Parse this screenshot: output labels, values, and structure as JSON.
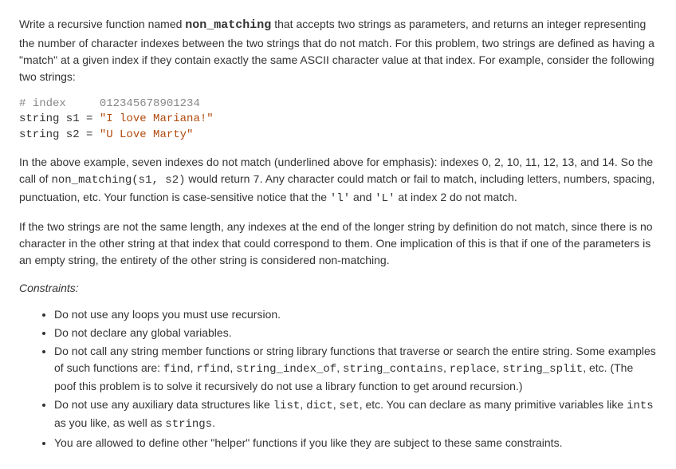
{
  "p1": {
    "t1": "Write a recursive function named ",
    "fn": "non_matching",
    "t2": " that accepts two strings as parameters, and returns an integer representing the number of character indexes between the two strings that do not match. For this problem, two strings are defined as having a \"match\" at a given index if they contain exactly the same ASCII character value at that index. For example, consider the following two strings:"
  },
  "code": {
    "l1a": "# index     ",
    "l1b": "012345678901234",
    "l2a": "string s1 = ",
    "l2b": "\"I love Mariana!\"",
    "l3a": "string s2 = ",
    "l3b": "\"U Love Marty\""
  },
  "p2": {
    "t1": "In the above example, seven indexes do not match (underlined above for emphasis): indexes 0, 2, 10, 11, 12, 13, and 14. So the call of ",
    "c1": "non_matching(s1, s2)",
    "t2": " would return ",
    "c2": "7",
    "t3": ". Any character could match or fail to match, including letters, numbers, spacing, punctuation, etc. Your function is case-sensitive notice that the ",
    "c3": "'l'",
    "t4": " and ",
    "c4": "'L'",
    "t5": " at index 2 do not match."
  },
  "p3": "If the two strings are not the same length, any indexes at the end of the longer string by definition do not match, since there is no character in the other string at that index that could correspond to them. One implication of this is that if one of the parameters is an empty string, the entirety of the other string is considered non-matching.",
  "constraints_label": "Constraints:",
  "bullets": {
    "b1": "Do not use any loops you must use recursion.",
    "b2": "Do not declare any global variables.",
    "b3": {
      "t1": "Do not call any string member functions or string library functions that traverse or search the entire string. Some examples of such functions are: ",
      "c1": "find",
      "t2": ", ",
      "c2": "rfind",
      "t3": ", ",
      "c3": "string_index_of",
      "t4": ", ",
      "c4": "string_contains",
      "t5": ", ",
      "c5": "replace",
      "t6": ", ",
      "c6": "string_split",
      "t7": ", etc. (The poof this problem is to solve it recursively do not use a library function to get around recursion.)"
    },
    "b4": {
      "t1": "Do not use any auxiliary data structures like ",
      "c1": "list",
      "t2": ", ",
      "c2": "dict",
      "t3": ", ",
      "c3": "set",
      "t4": ", etc. You can declare as many primitive variables like ",
      "c4": "ints",
      "t5": " as you like, as well as ",
      "c5": "strings",
      "t6": "."
    },
    "b5": "You are allowed to define other \"helper\" functions if you like they are subject to these same constraints."
  }
}
